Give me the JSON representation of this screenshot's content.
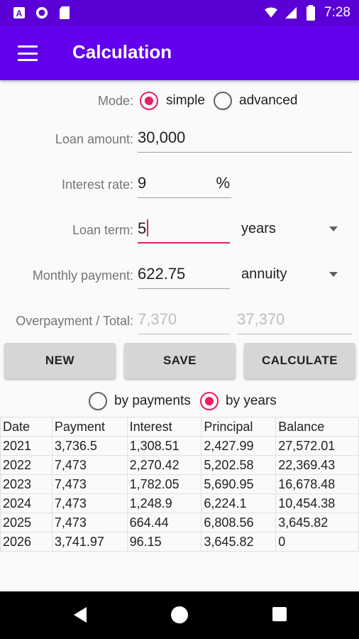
{
  "status_bar": {
    "time": "7:28",
    "icons": [
      "a-notification-icon",
      "circle-notification-icon",
      "sd-card-icon",
      "wifi-icon",
      "signal-icon",
      "battery-icon"
    ]
  },
  "app_bar": {
    "title": "Calculation",
    "menu_icon": "menu-icon"
  },
  "mode": {
    "label": "Mode:",
    "options": [
      "simple",
      "advanced"
    ],
    "selected": "simple"
  },
  "loan_amount": {
    "label": "Loan amount:",
    "value": "30,000"
  },
  "interest_rate": {
    "label": "Interest rate:",
    "value": "9",
    "unit": "%"
  },
  "loan_term": {
    "label": "Loan term:",
    "value": "5",
    "unit_selected": "years"
  },
  "monthly_payment": {
    "label": "Monthly payment:",
    "value": "622.75",
    "type_selected": "annuity"
  },
  "overpayment": {
    "label": "Overpayment / Total:",
    "overpayment": "7,370",
    "total": "37,370"
  },
  "buttons": {
    "new": "NEW",
    "save": "SAVE",
    "calculate": "CALCULATE"
  },
  "view_mode": {
    "options": [
      "by payments",
      "by years"
    ],
    "selected": "by years"
  },
  "table": {
    "headers": [
      "Date",
      "Payment",
      "Interest",
      "Principal",
      "Balance"
    ],
    "rows": [
      [
        "2021",
        "3,736.5",
        "1,308.51",
        "2,427.99",
        "27,572.01"
      ],
      [
        "2022",
        "7,473",
        "2,270.42",
        "5,202.58",
        "22,369.43"
      ],
      [
        "2023",
        "7,473",
        "1,782.05",
        "5,690.95",
        "16,678.48"
      ],
      [
        "2024",
        "7,473",
        "1,248.9",
        "6,224.1",
        "10,454.38"
      ],
      [
        "2025",
        "7,473",
        "664.44",
        "6,808.56",
        "3,645.82"
      ],
      [
        "2026",
        "3,741.97",
        "96.15",
        "3,645.82",
        "0"
      ]
    ]
  },
  "colors": {
    "status_bar": "#5a00d6",
    "app_bar": "#6200ee",
    "accent": "#e91e63",
    "nav_bar": "#000000"
  }
}
